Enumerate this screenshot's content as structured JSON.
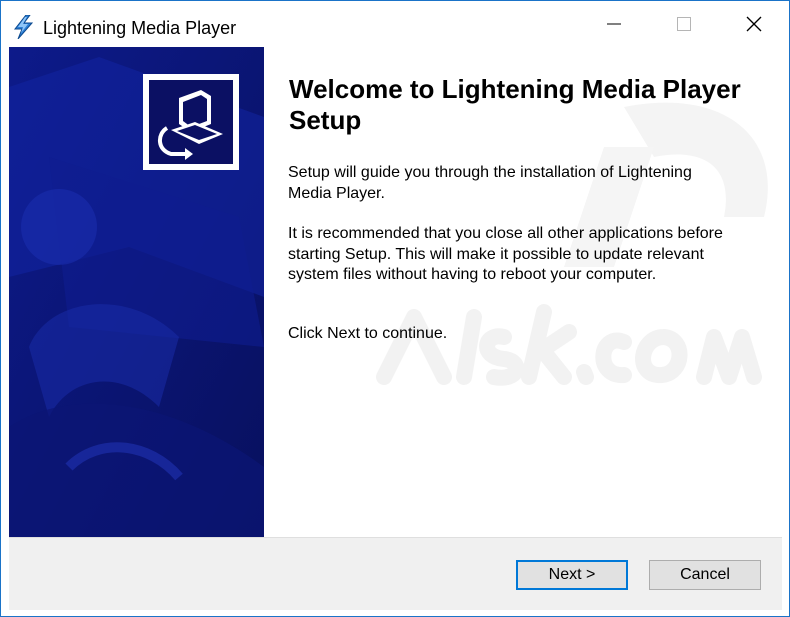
{
  "window": {
    "title": "Lightening Media Player",
    "app_icon": "lightning-bolt-icon",
    "controls": {
      "minimize": "minimize-icon",
      "maximize": "maximize-icon",
      "close": "close-icon"
    }
  },
  "sidebar": {
    "logo_icon": "computer-install-icon",
    "background_color": "#0b1063"
  },
  "content": {
    "heading": "Welcome to Lightening Media Player Setup",
    "paragraphs": [
      "Setup will guide you through the installation of Lightening Media Player.",
      "It is recommended that you close all other applications before starting Setup. This will make it possible to update relevant system files without having to reboot your computer.",
      "Click Next to continue."
    ]
  },
  "footer": {
    "next_label": "Next >",
    "cancel_label": "Cancel"
  },
  "colors": {
    "accent": "#0078d7",
    "titlebar_border": "#1a73c8",
    "footer_bg": "#f0f0f0"
  }
}
